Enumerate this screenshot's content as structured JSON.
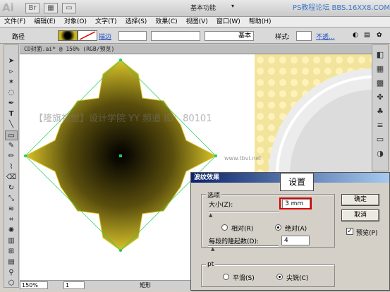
{
  "titlebar": {
    "logo": "Ai",
    "workspace": "基本功能",
    "brand": "PS教程论坛 BBS.16XX8.COM"
  },
  "menu": [
    "文件(F)",
    "编辑(E)",
    "对象(O)",
    "文字(T)",
    "选择(S)",
    "效果(C)",
    "视图(V)",
    "窗口(W)",
    "帮助(H)"
  ],
  "control": {
    "path_label": "路径",
    "stroke_link": "描边",
    "style_preset": "基本",
    "style_label": "样式:",
    "opacity_link": "不透...",
    "extra_glyph": "✿"
  },
  "document": {
    "tab": "CD封面.ai* @ 150% (RGB/预览)",
    "watermark": "【隆旗视觉】设计学院  YY 频道 ID：80101",
    "site_mark": "www.tbvi.net"
  },
  "status": {
    "zoom": "150%",
    "page": "1",
    "label": "矩形"
  },
  "dialog": {
    "title": "波纹效果",
    "options_group": "选项",
    "size_label": "大小(Z):",
    "size_value": "3 mm",
    "relative": "相对(R)",
    "absolute": "绝对(A)",
    "ridges_label": "每段的隆起数(D):",
    "ridges_value": "4",
    "points_group": "pt",
    "smooth": "平滑(S)",
    "corner": "尖锐(C)",
    "ok": "确定",
    "cancel": "取消",
    "preview": "预览(P)"
  },
  "callout": "设置",
  "colors": {
    "selection": "#22cc55",
    "highlight": "#d60000",
    "star_outer": "#d8c42a",
    "star_inner": "#000000"
  }
}
